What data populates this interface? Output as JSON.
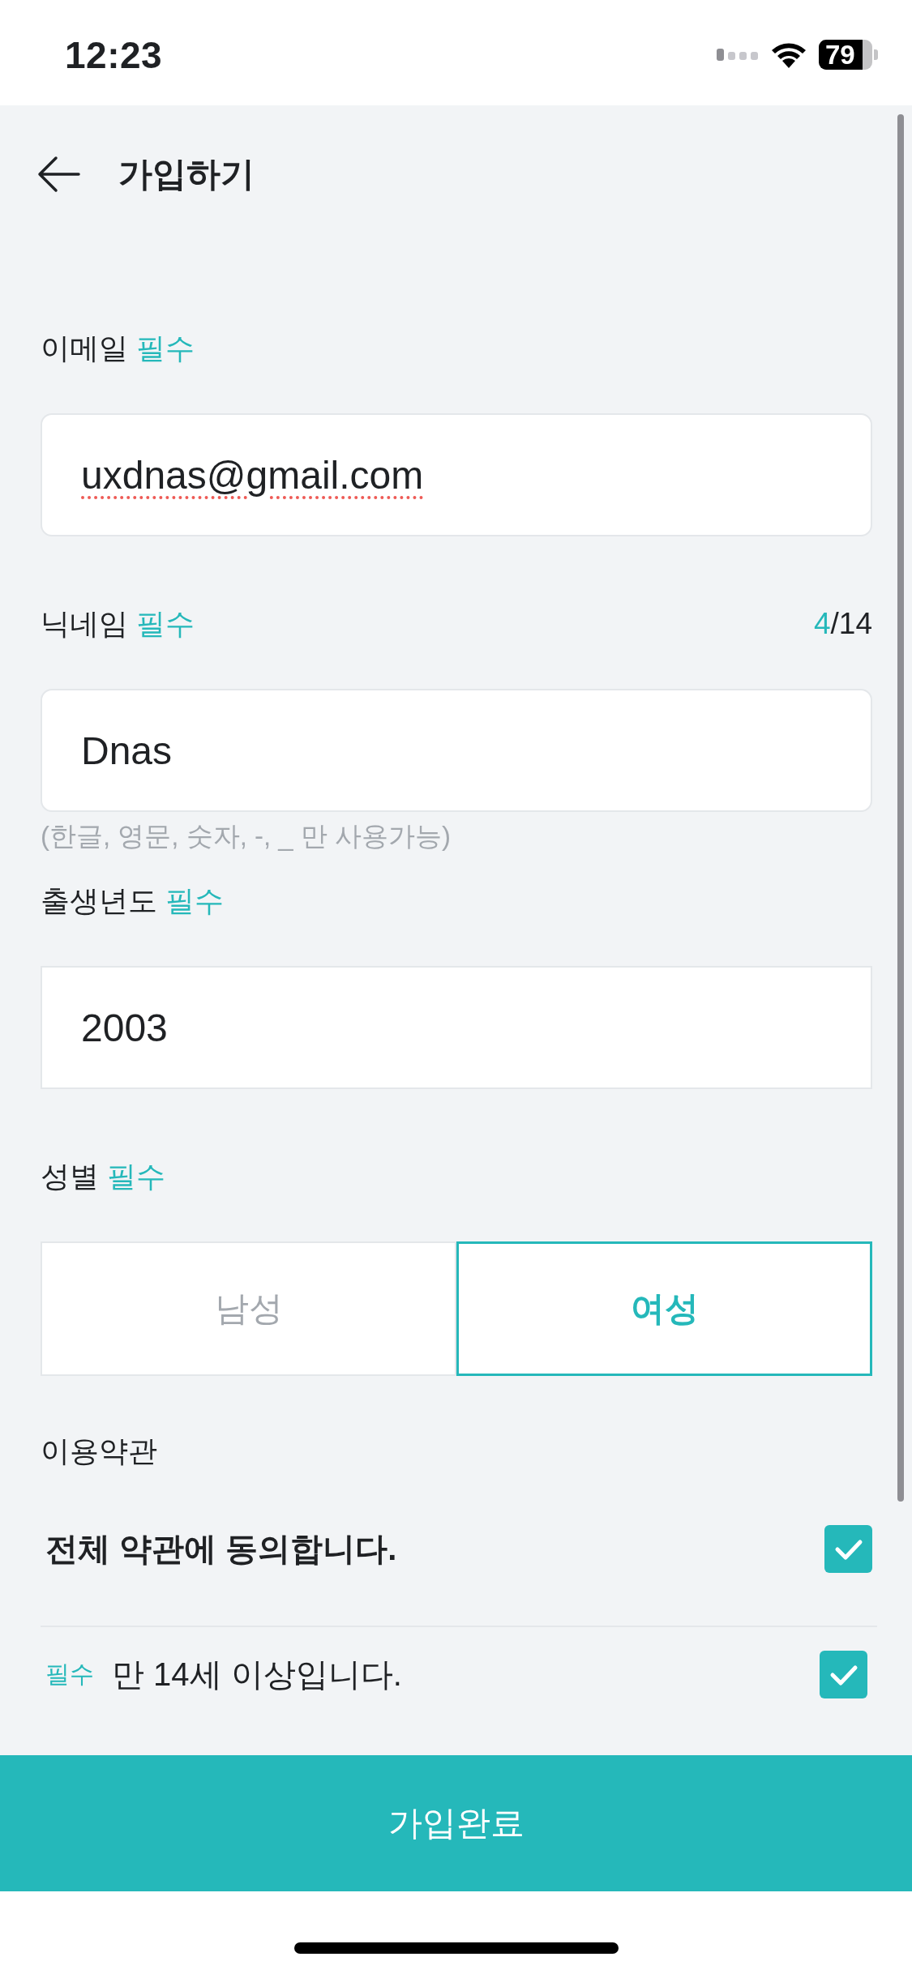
{
  "status_bar": {
    "time": "12:23",
    "battery": "79"
  },
  "header": {
    "title": "가입하기"
  },
  "fields": [
    {
      "kind": "text",
      "label": "이메일",
      "tag": "필수",
      "value": "uxdnas@gmail.com",
      "spelling_error": true
    },
    {
      "kind": "text",
      "label": "닉네임",
      "tag": "필수",
      "counter": {
        "current": "4",
        "limit": "/14"
      },
      "value": "Dnas",
      "spelling_error": false,
      "hint": "(한글, 영문, 숫자, -, _ 만 사용가능)"
    },
    {
      "kind": "picker",
      "label": "출생년도",
      "tag": "필수",
      "value": "2003",
      "spelling_error": false
    }
  ],
  "gender": {
    "label": "성별",
    "tag": "필수",
    "options": [
      {
        "label": "남성",
        "selected": false
      },
      {
        "label": "여성",
        "selected": true
      }
    ]
  },
  "terms": {
    "label": "이용약관",
    "agree_all": {
      "label": "전체 약관에 동의합니다.",
      "checked": true
    },
    "items": [
      {
        "tag": "필수",
        "label": "만 14세 이상입니다.",
        "checked": true
      }
    ]
  },
  "submit_button": {
    "label": "가입완료"
  }
}
